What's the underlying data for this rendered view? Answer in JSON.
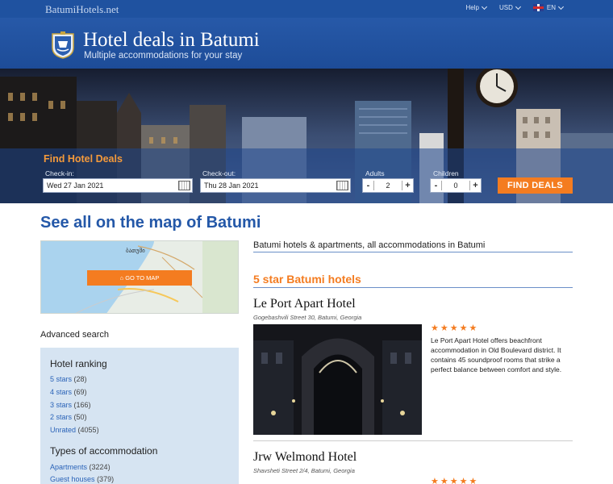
{
  "topbar": {
    "site_name": "BatumiHotels.net",
    "help_label": "Help",
    "currency_label": "USD",
    "language_label": "EN"
  },
  "header": {
    "title": "Hotel deals in Batumi",
    "subtitle": "Multiple accommodations for your stay"
  },
  "search": {
    "title": "Find Hotel Deals",
    "checkin_label": "Check-in:",
    "checkin_value": "Wed 27 Jan 2021",
    "checkout_label": "Check-out:",
    "checkout_value": "Thu 28 Jan 2021",
    "adults_label": "Adults",
    "adults_value": "2",
    "children_label": "Children",
    "children_value": "0",
    "minus": "-",
    "plus": "+",
    "button_label": "FIND DEALS"
  },
  "map": {
    "heading": "See all on the map of Batumi",
    "button_label": "GO TO MAP",
    "map_label": "ბათუმი"
  },
  "filters": {
    "advanced_label": "Advanced search",
    "ranking_heading": "Hotel ranking",
    "ranking": [
      {
        "label": "5 stars",
        "count": "(28)"
      },
      {
        "label": "4 stars",
        "count": "(69)"
      },
      {
        "label": "3 stars",
        "count": "(166)"
      },
      {
        "label": "2 stars",
        "count": "(50)"
      },
      {
        "label": "Unrated",
        "count": "(4055)"
      }
    ],
    "types_heading": "Types of accommodation",
    "types": [
      {
        "label": "Apartments",
        "count": "(3224)"
      },
      {
        "label": "Guest houses",
        "count": "(379)"
      }
    ]
  },
  "main": {
    "intro": "Batumi hotels & apartments, all accommodations in Batumi",
    "section_title": "5 star Batumi hotels",
    "hotels": [
      {
        "name": "Le Port Apart Hotel",
        "address": "Gogebashvili Street 30, Batumi, Georgia",
        "stars": "★★★★★",
        "description": "Le Port Apart Hotel offers beachfront accommodation in Old Boulevard district. It contains 45 soundproof rooms that strike a perfect balance between comfort and style."
      },
      {
        "name": "Jrw Welmond Hotel",
        "address": "Shavsheti Street 2/4, Batumi, Georgia",
        "stars": "★★★★★"
      }
    ]
  },
  "colors": {
    "brand_blue": "#1f52a0",
    "accent_orange": "#f47c20",
    "link_blue": "#2a63b8",
    "filter_bg": "#d6e4f2"
  }
}
